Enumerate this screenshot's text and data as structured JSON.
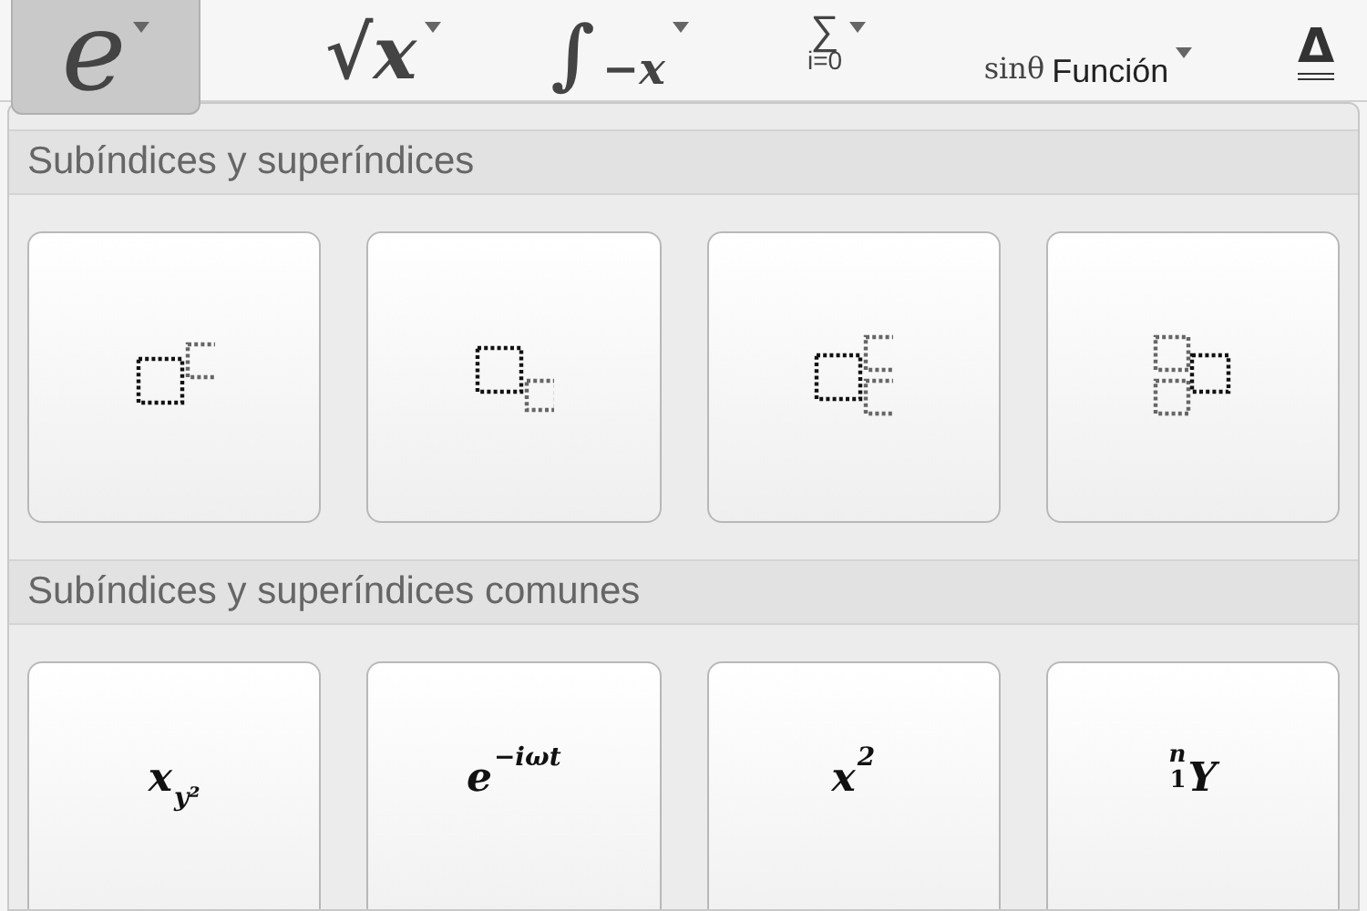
{
  "toolbar": [
    {
      "kind": "script",
      "symbol": "e",
      "selected": true
    },
    {
      "kind": "radical",
      "symbol": "√x",
      "selected": false
    },
    {
      "kind": "integral",
      "symbol": "∫",
      "lower": "−x",
      "selected": false
    },
    {
      "kind": "sum",
      "symbol": "∑",
      "lower": "i=0",
      "selected": false
    },
    {
      "kind": "function",
      "symbol": "sinθ",
      "label": "Función",
      "selected": false
    },
    {
      "kind": "accent",
      "symbol": "Δ",
      "selected": false
    }
  ],
  "sections": [
    {
      "title": "Subíndices y superíndices",
      "items": [
        {
          "kind": "superscript"
        },
        {
          "kind": "subscript"
        },
        {
          "kind": "subsup"
        },
        {
          "kind": "presubsup"
        }
      ]
    },
    {
      "title": "Subíndices y superíndices comunes",
      "items": [
        {
          "kind": "formula",
          "base": "x",
          "sub": "y²"
        },
        {
          "kind": "formula",
          "base": "e",
          "sup": "−iωt"
        },
        {
          "kind": "formula",
          "base": "x",
          "sup": "2"
        },
        {
          "kind": "formula",
          "base": "Y",
          "pre_sup": "n",
          "pre_sub": "1"
        }
      ]
    }
  ]
}
